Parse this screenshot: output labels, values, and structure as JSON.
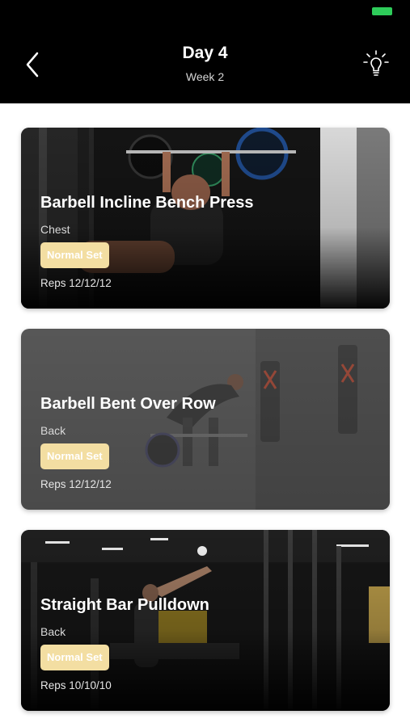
{
  "header": {
    "title": "Day 4",
    "subtitle": "Week 2",
    "back_icon": "chevron-left-icon",
    "tip_icon": "lightbulb-icon",
    "battery_color": "#2ecc5a"
  },
  "exercises": [
    {
      "name": "Barbell Incline Bench Press",
      "muscle": "Chest",
      "set_type": "Normal Set",
      "reps": "Reps 12/12/12"
    },
    {
      "name": "Barbell Bent Over Row",
      "muscle": "Back",
      "set_type": "Normal Set",
      "reps": "Reps 12/12/12"
    },
    {
      "name": "Straight Bar Pulldown",
      "muscle": "Back",
      "set_type": "Normal Set",
      "reps": "Reps 10/10/10"
    }
  ],
  "colors": {
    "header_bg": "#000000",
    "badge_bg": "#f3dea2",
    "card2_bg": "#555555"
  }
}
